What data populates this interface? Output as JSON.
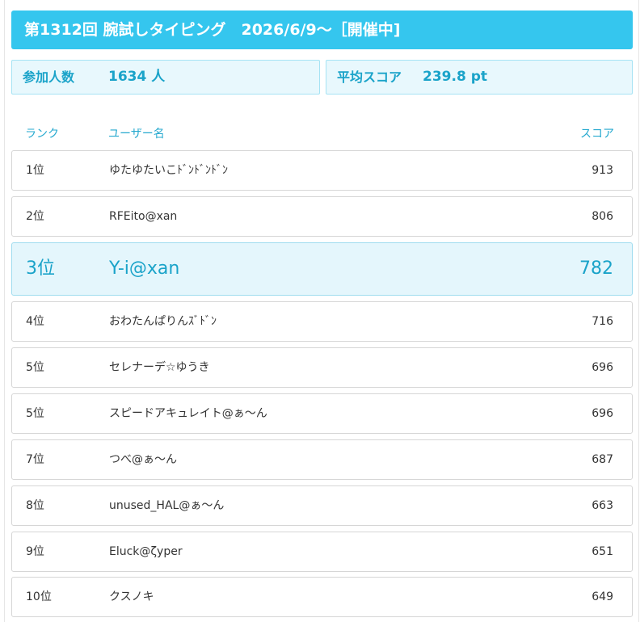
{
  "banner": {
    "title": "第1312回 腕試しタイピング　2026/6/9〜［開催中]"
  },
  "stats": {
    "participants_label": "参加人数",
    "participants_value": "1634 人",
    "average_label": "平均スコア",
    "average_value": "239.8 pt"
  },
  "table": {
    "headers": {
      "rank": "ランク",
      "name": "ユーザー名",
      "score": "スコア"
    },
    "rows": [
      {
        "rank": "1位",
        "name": "ゆたゆたいこﾄﾞﾝﾄﾞﾝﾄﾞﾝ",
        "score": "913"
      },
      {
        "rank": "2位",
        "name": "RFEito@xan",
        "score": "806"
      },
      {
        "rank": "3位",
        "name": "Y-i@xan",
        "score": "782"
      },
      {
        "rank": "4位",
        "name": "おわたんぱりんｽﾞﾄﾞﾝ",
        "score": "716"
      },
      {
        "rank": "5位",
        "name": "セレナーデ☆ゆうき",
        "score": "696"
      },
      {
        "rank": "5位",
        "name": "スピードアキュレイト@ぁ〜ん",
        "score": "696"
      },
      {
        "rank": "7位",
        "name": "つべ@ぁ〜ん",
        "score": "687"
      },
      {
        "rank": "8位",
        "name": "unused_HAL@ぁ〜ん",
        "score": "663"
      },
      {
        "rank": "9位",
        "name": "Eluck@ζyper",
        "score": "651"
      },
      {
        "rank": "10位",
        "name": "クスノキ",
        "score": "649"
      }
    ]
  }
}
